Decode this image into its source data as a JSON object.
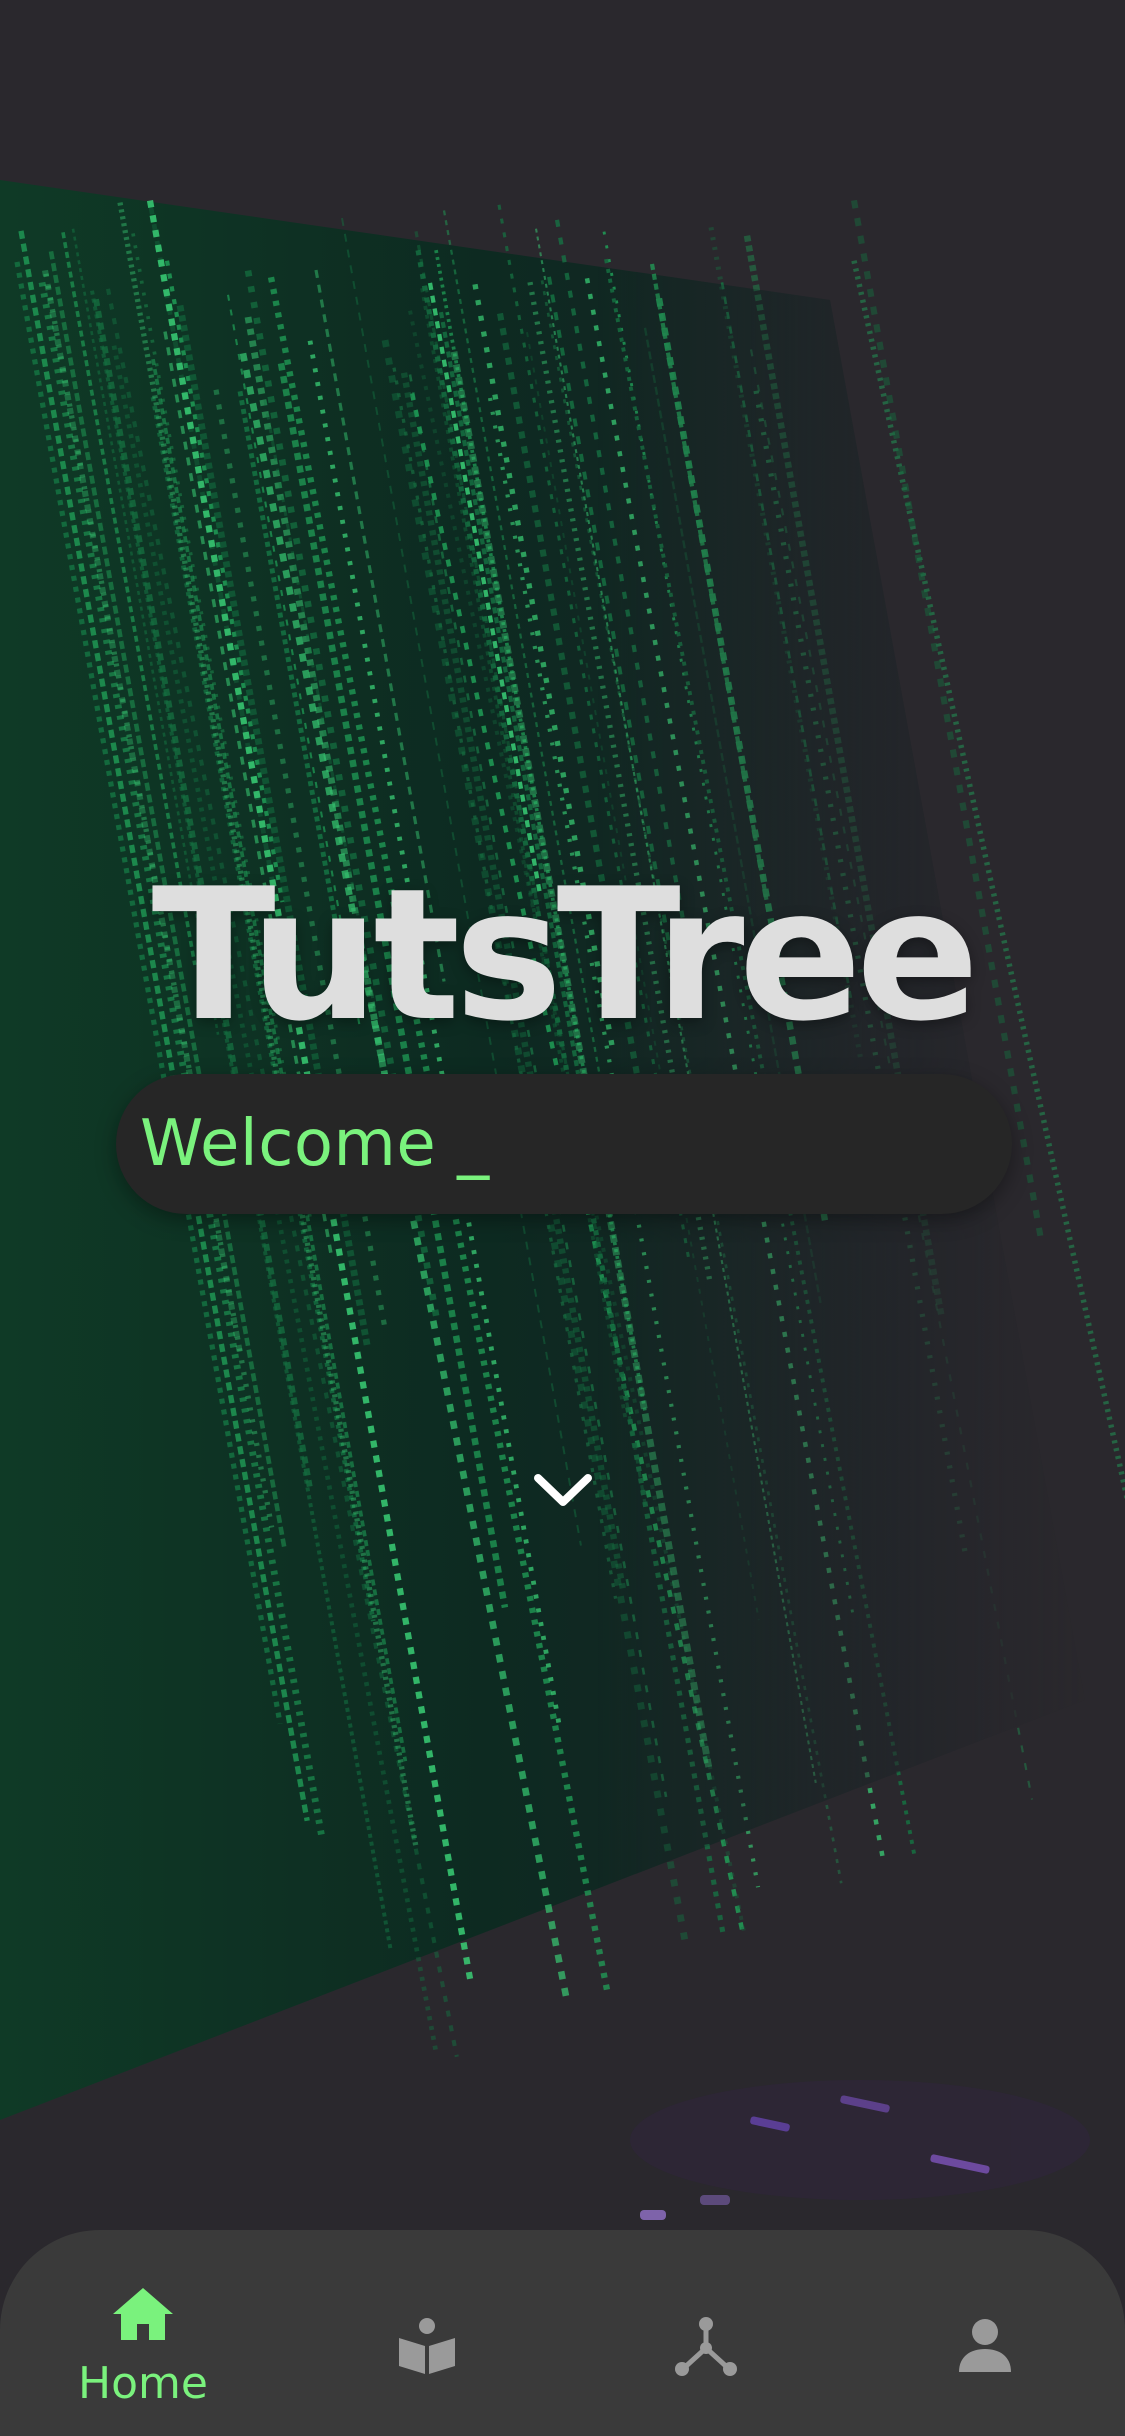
{
  "app": {
    "title": "TutsTree",
    "welcome_text": "Welcome _"
  },
  "colors": {
    "accent": "#7af27d",
    "title": "#dedede",
    "nav_background": "#3a3a3a",
    "nav_inactive_icon": "#9a9a9a",
    "welcome_background": "#262626"
  },
  "hero": {
    "background_image": "laptop-screen-green-code"
  },
  "scroll_hint": {
    "icon": "chevron-down-icon"
  },
  "bottom_nav": {
    "active_index": 0,
    "items": [
      {
        "label": "Home",
        "icon": "home-icon",
        "active": true
      },
      {
        "label": "",
        "icon": "book-reader-icon",
        "active": false
      },
      {
        "label": "",
        "icon": "tree-nodes-icon",
        "active": false
      },
      {
        "label": "",
        "icon": "user-icon",
        "active": false
      }
    ]
  }
}
